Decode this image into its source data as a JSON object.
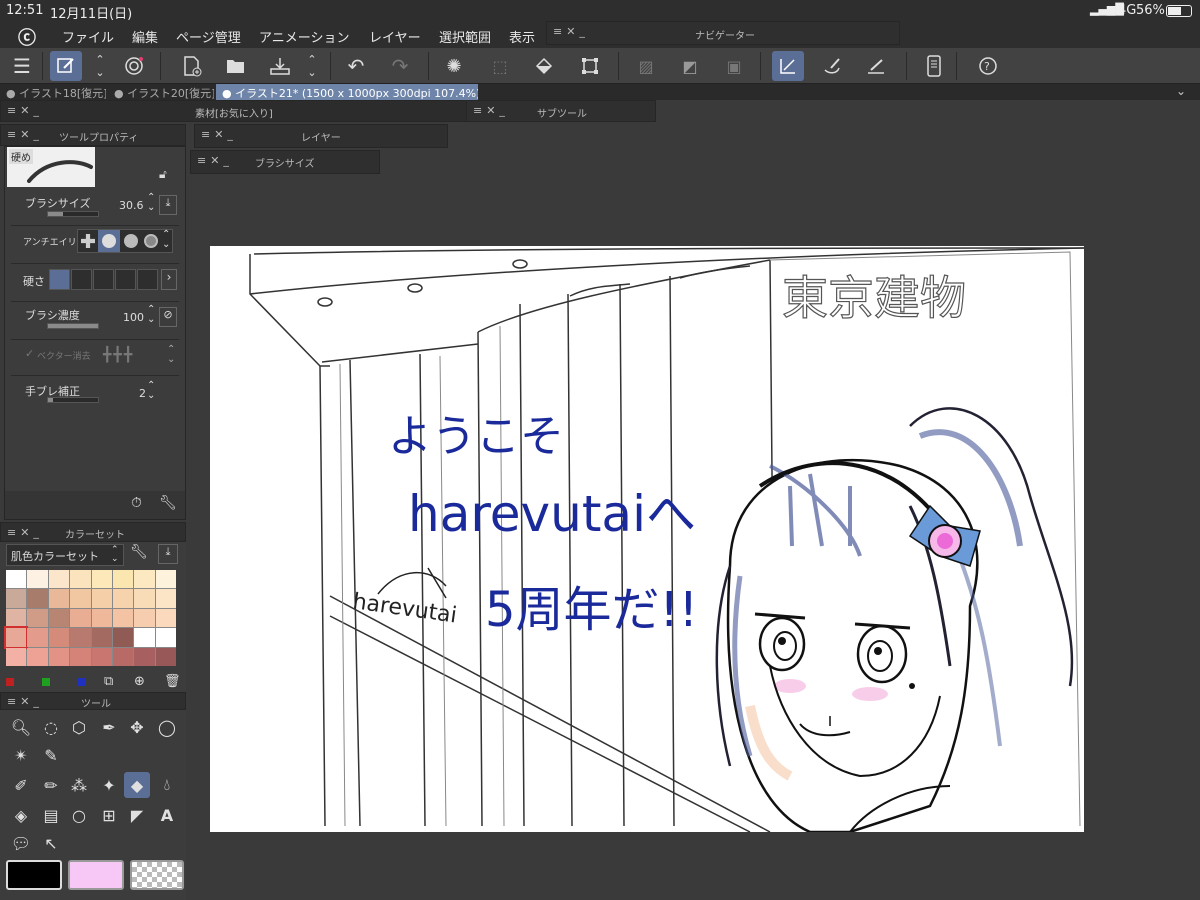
{
  "status": {
    "time": "12:51",
    "date": "12月11日(日)",
    "signal": "4G",
    "battery": "56%"
  },
  "menu": [
    "ファイル",
    "編集",
    "ページ管理",
    "アニメーション",
    "レイヤー",
    "選択範囲",
    "表示"
  ],
  "tabs": [
    {
      "label": "● イラスト18[復元]"
    },
    {
      "label": "● イラスト20[復元]"
    },
    {
      "label": "● イラスト21* (1500 x 1000px 300dpi 107.4%)"
    }
  ],
  "panels": {
    "navigator": "ナビゲーター",
    "materials": "素材[お気に入り]",
    "subtool": "サブツール",
    "layer": "レイヤー",
    "brushsize": "ブラシサイズ",
    "toolprop": "ツールプロパティ",
    "colorset": "カラーセット",
    "tools": "ツール"
  },
  "toolprop": {
    "brush_name": "硬め",
    "brush_size_label": "ブラシサイズ",
    "brush_size_value": "30.6",
    "brush_size_fill": 0.3,
    "antialias_label": "アンチエイリアス",
    "hardness_label": "硬さ",
    "density_label": "ブラシ濃度",
    "density_value": "100",
    "density_fill": 1.0,
    "vector_label": "ベクター消去",
    "stabilizer_label": "手ブレ補正",
    "stabilizer_value": "2",
    "stabilizer_fill": 0.1
  },
  "colorset": {
    "set_name": "肌色カラーセット",
    "colors": [
      "#ffffff",
      "#fdf1e3",
      "#fbe6cc",
      "#fbe3bd",
      "#fce8b8",
      "#fbe6b0",
      "#fce9c2",
      "#fdf3dc",
      "#c9a99a",
      "#a77c6b",
      "#e8b898",
      "#f0c7a0",
      "#f4cfa8",
      "#f6d3ad",
      "#f8dcb8",
      "#fbe5c6",
      "#e0b4a3",
      "#d09c88",
      "#b88572",
      "#e8ad92",
      "#f0b89b",
      "#f3c3a4",
      "#f6cdae",
      "#fad9bd",
      "#e8a898",
      "#e39c8b",
      "#d48b7a",
      "#b87a6e",
      "#a36a62",
      "#905a55",
      "#ffffff",
      "#ffffff",
      "#f3b0a4",
      "#eea296",
      "#e39386",
      "#d58379",
      "#c8766f",
      "#b86a66",
      "#a85f5f",
      "#985858"
    ]
  },
  "colors": {
    "main": "#000000",
    "sub": "#f7c8f5",
    "accent": "#5a6e96"
  },
  "canvas": {
    "sign": "東京建物",
    "welcome_line1": "ようこそ",
    "welcome_line2": "harevutaiへ",
    "welcome_line3": "5周年だ!!",
    "logo": "harevutai"
  }
}
